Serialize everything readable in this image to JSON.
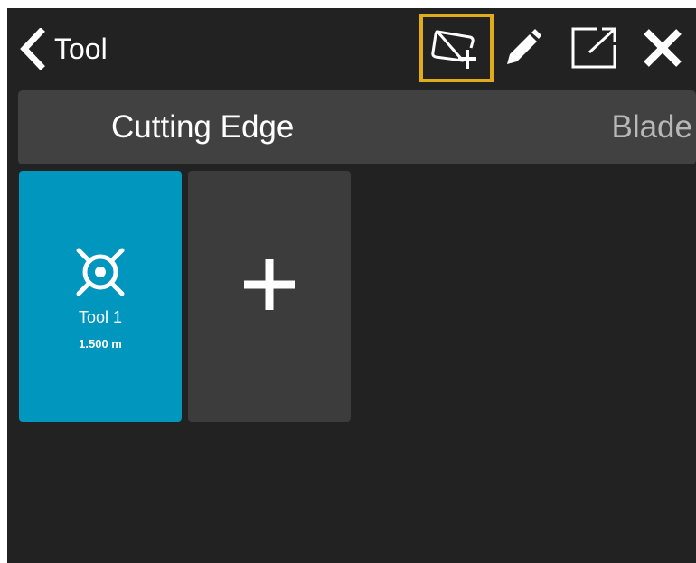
{
  "header": {
    "title": "Tool",
    "icons": {
      "back": "chevron-left-icon",
      "add_tool": "add-tool-icon",
      "edit": "pencil-icon",
      "export": "external-link-icon",
      "close": "close-icon"
    }
  },
  "tabs": [
    {
      "label": "Cutting Edge",
      "active": true
    },
    {
      "label": "Blade",
      "active": false
    }
  ],
  "tools": [
    {
      "name": "Tool 1",
      "size": "1.500 m",
      "icon": "crosshair-target-icon"
    }
  ],
  "add_tile_icon": "plus-icon",
  "colors": {
    "background": "#222222",
    "tab_bar": "#414141",
    "tool_tile": "#0096bd",
    "add_tile": "#3c3c3c",
    "selection_highlight": "#e0ac1c"
  }
}
